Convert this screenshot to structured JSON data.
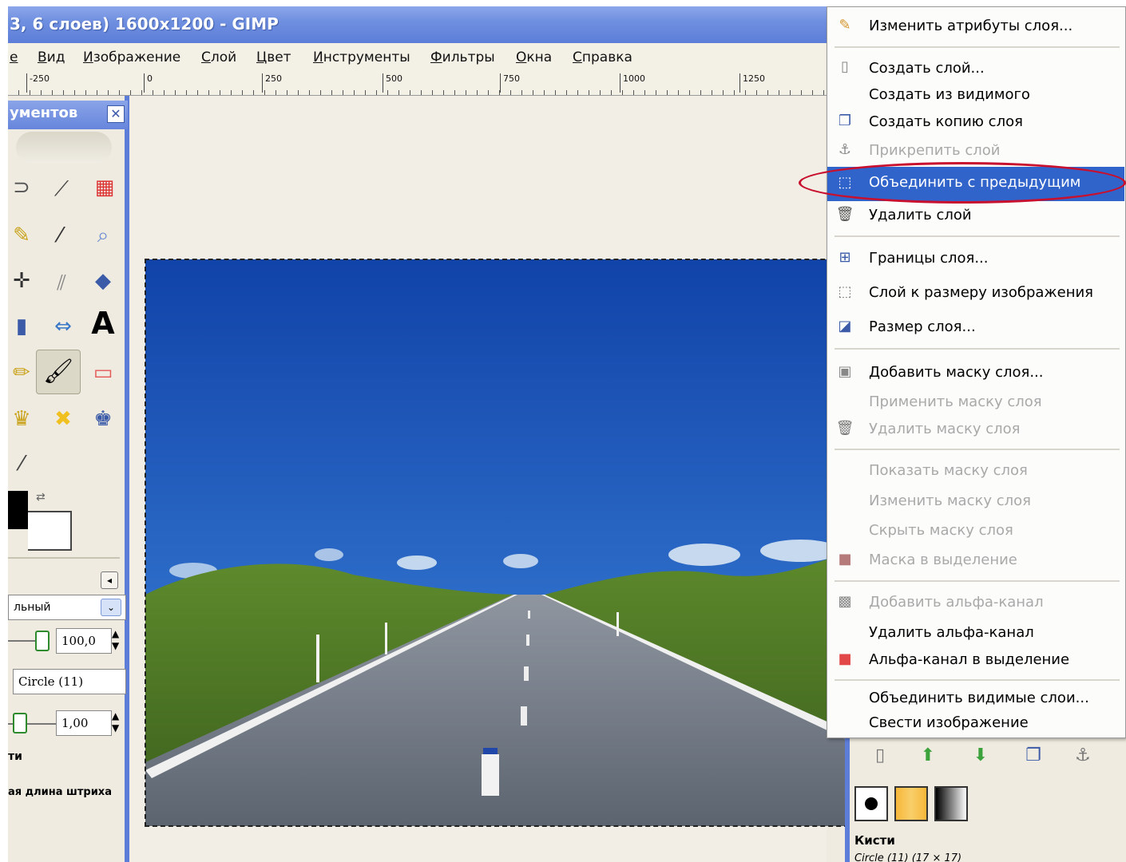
{
  "window": {
    "title": "3, 6 слоев) 1600x1200 - GIMP"
  },
  "menubar": {
    "items": [
      "е",
      "Вид",
      "Изображение",
      "Слой",
      "Цвет",
      "Инструменты",
      "Фильтры",
      "Окна",
      "Справка"
    ]
  },
  "ruler": {
    "labels": [
      "-250",
      "0",
      "250",
      "500",
      "750",
      "1000",
      "1250"
    ]
  },
  "toolbox": {
    "title": "ументов",
    "mode_value": "льный",
    "opacity_value": "100,0",
    "brush_value": "Circle (11)",
    "scale_value": "1,00",
    "label_1": "ти",
    "label_2": "ая длина штриха"
  },
  "context_menu": {
    "items": [
      {
        "label": "Изменить атрибуты слоя...",
        "icon": "edit-layer-icon",
        "enabled": true
      },
      {
        "label": "Создать слой...",
        "icon": "new-layer-icon",
        "enabled": true
      },
      {
        "label": "Создать из видимого",
        "icon": "",
        "enabled": true
      },
      {
        "label": "Создать копию слоя",
        "icon": "duplicate-layer-icon",
        "enabled": true
      },
      {
        "label": "Прикрепить слой",
        "icon": "anchor-icon",
        "enabled": false
      },
      {
        "label": "Объединить с предыдущим",
        "icon": "merge-down-icon",
        "enabled": true,
        "highlighted": true
      },
      {
        "label": "Удалить слой",
        "icon": "trash-icon",
        "enabled": true
      },
      {
        "label": "Границы слоя...",
        "icon": "layer-boundary-icon",
        "enabled": true
      },
      {
        "label": "Слой к размеру изображения",
        "icon": "layer-to-image-size-icon",
        "enabled": true
      },
      {
        "label": "Размер слоя...",
        "icon": "scale-layer-icon",
        "enabled": true
      },
      {
        "label": "Добавить маску слоя...",
        "icon": "add-mask-icon",
        "enabled": true
      },
      {
        "label": "Применить маску слоя",
        "icon": "",
        "enabled": false
      },
      {
        "label": "Удалить маску слоя",
        "icon": "trash-icon",
        "enabled": false
      },
      {
        "label": "Показать маску слоя",
        "icon": "",
        "enabled": false
      },
      {
        "label": "Изменить маску слоя",
        "icon": "",
        "enabled": false
      },
      {
        "label": "Скрыть маску слоя",
        "icon": "",
        "enabled": false
      },
      {
        "label": "Маска в выделение",
        "icon": "mask-to-selection-icon",
        "enabled": false
      },
      {
        "label": "Добавить альфа-канал",
        "icon": "alpha-icon",
        "enabled": false
      },
      {
        "label": "Удалить альфа-канал",
        "icon": "",
        "enabled": true
      },
      {
        "label": "Альфа-канал в выделение",
        "icon": "alpha-to-selection-icon",
        "enabled": true
      },
      {
        "label": "Объединить видимые слои...",
        "icon": "",
        "enabled": true
      },
      {
        "label": "Свести изображение",
        "icon": "",
        "enabled": true
      }
    ]
  },
  "dock": {
    "brushes_label": "Кисти",
    "brush_info": "Circle (11) (17 × 17)"
  },
  "colors": {
    "title_bar": "#6f8fe0",
    "highlight": "#3164cb",
    "annotation_ellipse": "#c8102e"
  }
}
